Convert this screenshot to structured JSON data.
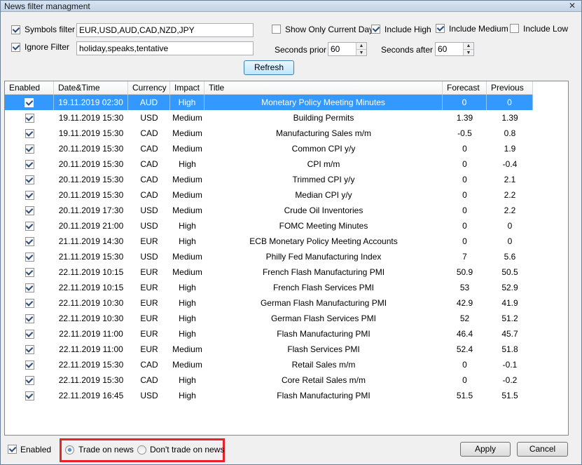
{
  "window": {
    "title": "News filter managment",
    "close_glyph": "✕"
  },
  "filters": {
    "symbols_filter": {
      "label": "Symbols filter",
      "checked": true,
      "value": "EUR,USD,AUD,CAD,NZD,JPY"
    },
    "ignore_filter": {
      "label": "Ignore Filter",
      "checked": true,
      "value": "holiday,speaks,tentative"
    },
    "show_only_current_day": {
      "label": "Show Only Current Day",
      "checked": false
    },
    "include_high": {
      "label": "Include High",
      "checked": true
    },
    "include_medium": {
      "label": "Include Medium",
      "checked": true
    },
    "include_low": {
      "label": "Include Low",
      "checked": false
    },
    "seconds_prior": {
      "label": "Seconds prior",
      "value": "60"
    },
    "seconds_after": {
      "label": "Seconds after",
      "value": "60"
    },
    "refresh_label": "Refresh"
  },
  "grid": {
    "columns": [
      "Enabled",
      "Date&Time",
      "Currency",
      "Impact",
      "Title",
      "Forecast",
      "Previous"
    ],
    "rows": [
      {
        "enabled": true,
        "datetime": "19.11.2019 02:30",
        "currency": "AUD",
        "impact": "High",
        "title": "Monetary Policy Meeting Minutes",
        "forecast": "0",
        "previous": "0",
        "selected": true
      },
      {
        "enabled": true,
        "datetime": "19.11.2019 15:30",
        "currency": "USD",
        "impact": "Medium",
        "title": "Building Permits",
        "forecast": "1.39",
        "previous": "1.39"
      },
      {
        "enabled": true,
        "datetime": "19.11.2019 15:30",
        "currency": "CAD",
        "impact": "Medium",
        "title": "Manufacturing Sales m/m",
        "forecast": "-0.5",
        "previous": "0.8"
      },
      {
        "enabled": true,
        "datetime": "20.11.2019 15:30",
        "currency": "CAD",
        "impact": "Medium",
        "title": "Common CPI y/y",
        "forecast": "0",
        "previous": "1.9"
      },
      {
        "enabled": true,
        "datetime": "20.11.2019 15:30",
        "currency": "CAD",
        "impact": "High",
        "title": "CPI m/m",
        "forecast": "0",
        "previous": "-0.4"
      },
      {
        "enabled": true,
        "datetime": "20.11.2019 15:30",
        "currency": "CAD",
        "impact": "Medium",
        "title": "Trimmed CPI y/y",
        "forecast": "0",
        "previous": "2.1"
      },
      {
        "enabled": true,
        "datetime": "20.11.2019 15:30",
        "currency": "CAD",
        "impact": "Medium",
        "title": "Median CPI y/y",
        "forecast": "0",
        "previous": "2.2"
      },
      {
        "enabled": true,
        "datetime": "20.11.2019 17:30",
        "currency": "USD",
        "impact": "Medium",
        "title": "Crude Oil Inventories",
        "forecast": "0",
        "previous": "2.2"
      },
      {
        "enabled": true,
        "datetime": "20.11.2019 21:00",
        "currency": "USD",
        "impact": "High",
        "title": "FOMC Meeting Minutes",
        "forecast": "0",
        "previous": "0"
      },
      {
        "enabled": true,
        "datetime": "21.11.2019 14:30",
        "currency": "EUR",
        "impact": "High",
        "title": "ECB Monetary Policy Meeting Accounts",
        "forecast": "0",
        "previous": "0"
      },
      {
        "enabled": true,
        "datetime": "21.11.2019 15:30",
        "currency": "USD",
        "impact": "Medium",
        "title": "Philly Fed Manufacturing Index",
        "forecast": "7",
        "previous": "5.6"
      },
      {
        "enabled": true,
        "datetime": "22.11.2019 10:15",
        "currency": "EUR",
        "impact": "Medium",
        "title": "French Flash Manufacturing PMI",
        "forecast": "50.9",
        "previous": "50.5"
      },
      {
        "enabled": true,
        "datetime": "22.11.2019 10:15",
        "currency": "EUR",
        "impact": "High",
        "title": "French Flash Services PMI",
        "forecast": "53",
        "previous": "52.9"
      },
      {
        "enabled": true,
        "datetime": "22.11.2019 10:30",
        "currency": "EUR",
        "impact": "High",
        "title": "German Flash Manufacturing PMI",
        "forecast": "42.9",
        "previous": "41.9"
      },
      {
        "enabled": true,
        "datetime": "22.11.2019 10:30",
        "currency": "EUR",
        "impact": "High",
        "title": "German Flash Services PMI",
        "forecast": "52",
        "previous": "51.2"
      },
      {
        "enabled": true,
        "datetime": "22.11.2019 11:00",
        "currency": "EUR",
        "impact": "High",
        "title": "Flash Manufacturing PMI",
        "forecast": "46.4",
        "previous": "45.7"
      },
      {
        "enabled": true,
        "datetime": "22.11.2019 11:00",
        "currency": "EUR",
        "impact": "Medium",
        "title": "Flash Services PMI",
        "forecast": "52.4",
        "previous": "51.8"
      },
      {
        "enabled": true,
        "datetime": "22.11.2019 15:30",
        "currency": "CAD",
        "impact": "Medium",
        "title": "Retail Sales m/m",
        "forecast": "0",
        "previous": "-0.1"
      },
      {
        "enabled": true,
        "datetime": "22.11.2019 15:30",
        "currency": "CAD",
        "impact": "High",
        "title": "Core Retail Sales m/m",
        "forecast": "0",
        "previous": "-0.2"
      },
      {
        "enabled": true,
        "datetime": "22.11.2019 16:45",
        "currency": "USD",
        "impact": "High",
        "title": "Flash Manufacturing PMI",
        "forecast": "51.5",
        "previous": "51.5"
      }
    ]
  },
  "footer": {
    "enabled": {
      "label": "Enabled",
      "checked": true
    },
    "trade_on_news": {
      "label": "Trade on news",
      "selected": true
    },
    "dont_trade_on_news": {
      "label": "Don't trade on news",
      "selected": false
    },
    "apply_label": "Apply",
    "cancel_label": "Cancel",
    "highlight_color": "#e8222a"
  },
  "icons": {
    "close": "close-icon",
    "spin_up": "spin-up-icon",
    "spin_down": "spin-down-icon"
  }
}
